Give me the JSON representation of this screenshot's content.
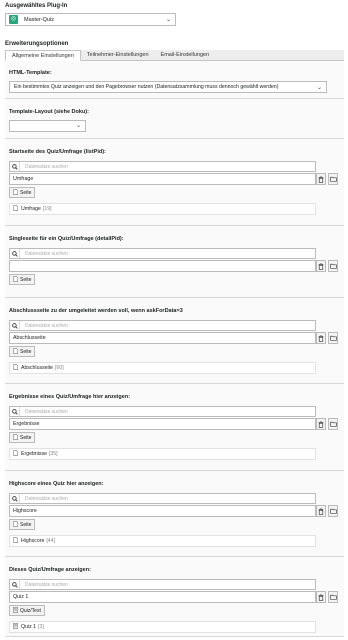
{
  "plugin": {
    "title": "Ausgewähltes Plug-In",
    "selected": "Master-Quiz"
  },
  "extensions": {
    "title": "Erweiterungsoptionen",
    "tabs": [
      "Allgemeine Einstellungen",
      "Teilnehmer-Einstellungen",
      "Email-Einstellungen"
    ]
  },
  "html_template": {
    "label": "HTML-Template:",
    "value": "Ein bestimmtes Quiz anzeigen und den Pagebrowser nutzen (Datensatzsammlung muss dennoch gewählt werden)"
  },
  "template_layout": {
    "label": "Template-Layout (siehe Doku):",
    "value": ""
  },
  "search_placeholder": "Datensätze suchen",
  "sections": [
    {
      "label": "Startseite des Quiz/Umfrage (listPid):",
      "value": "Umfrage",
      "button": "Seite",
      "item": "Umfrage",
      "uid": "[19]"
    },
    {
      "label": "Singleseite für ein Quiz/Umfrage (detailPid):",
      "value": "",
      "button": "Seite",
      "item": "",
      "uid": ""
    },
    {
      "label": "Abschlussseite zu der umgeleitet werden soll, wenn askForData=3",
      "value": "Abschlusseite",
      "button": "Seite",
      "item": "Abschlusseite",
      "uid": "[60]"
    },
    {
      "label": "Ergebnisse eines Quiz/Umfrage hier anzeigen:",
      "value": "Ergebnisse",
      "button": "Seite",
      "item": "Ergebnisse",
      "uid": "[35]"
    },
    {
      "label": "Highscore eines Quiz hier anzeigen:",
      "value": "Highscore",
      "button": "Seite",
      "item": "Highscore",
      "uid": "[44]"
    },
    {
      "label": "Dieses Quiz/Umfrage anzeigen:",
      "value": "Quiz 1",
      "button": "Quiz/Test",
      "item": "Quiz 1",
      "uid": "[3]"
    }
  ],
  "colors": {
    "plugin_icon": "#26a67a",
    "border": "#bbbbbb"
  },
  "icons": {
    "search": "search-icon",
    "trash": "trash-icon",
    "folder": "folder-icon",
    "page": "page-icon",
    "quiz": "quiz-icon",
    "chevron": "chevron-down-icon"
  }
}
